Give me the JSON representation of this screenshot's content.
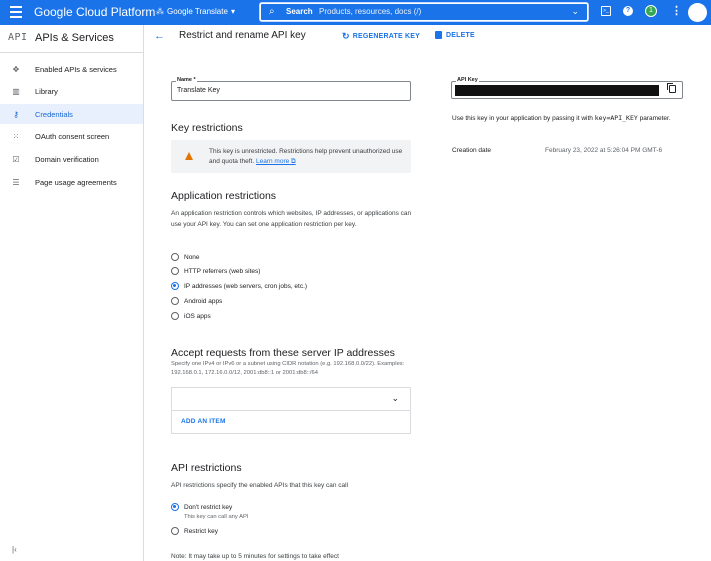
{
  "topbar": {
    "brand": "Google Cloud Platform",
    "project": "Google Translate",
    "search_label": "Search",
    "search_placeholder": "Products, resources, docs (/)",
    "notification_count": "1"
  },
  "sidebar": {
    "logo": "API",
    "title": "APIs & Services",
    "items": [
      {
        "label": "Enabled APIs & services",
        "icon": "diamond-grid-icon"
      },
      {
        "label": "Library",
        "icon": "library-icon"
      },
      {
        "label": "Credentials",
        "icon": "key-icon",
        "active": true
      },
      {
        "label": "OAuth consent screen",
        "icon": "consent-grid-icon"
      },
      {
        "label": "Domain verification",
        "icon": "domain-check-icon"
      },
      {
        "label": "Page usage agreements",
        "icon": "settings-list-icon"
      }
    ]
  },
  "header": {
    "title": "Restrict and rename API key",
    "regenerate": "REGENERATE KEY",
    "delete": "DELETE"
  },
  "form": {
    "name_label": "Name *",
    "name_value": "Translate Key",
    "key_restrictions_heading": "Key restrictions",
    "warning_text": "This key is unrestricted. Restrictions help prevent unauthorized use and quota theft.",
    "learn_more": "Learn more",
    "app_restrictions_heading": "Application restrictions",
    "app_restrictions_desc": "An application restriction controls which websites, IP addresses, or applications can use your API key. You can set one application restriction per key.",
    "app_options": [
      "None",
      "HTTP referrers (web sites)",
      "IP addresses (web servers, cron jobs, etc.)",
      "Android apps",
      "iOS apps"
    ],
    "app_selected": "IP addresses (web servers, cron jobs, etc.)",
    "ip_heading": "Accept requests from these server IP addresses",
    "ip_desc": "Specify one IPv4 or IPv6 or a subnet using CIDR notation (e.g. 192.168.0.0/22). Examples: 192.168.0.1, 172.16.0.0/12, 2001:db8::1 or 2001:db8::/64",
    "add_item": "ADD AN ITEM",
    "api_restrictions_heading": "API restrictions",
    "api_restrictions_desc": "API restrictions specify the enabled APIs that this key can call",
    "api_options": [
      "Don't restrict key",
      "Restrict key"
    ],
    "api_selected": "Don't restrict key",
    "api_option_sub": "This key can call any API",
    "note": "Note: It may take up to 5 minutes for settings to take effect"
  },
  "key_panel": {
    "label": "API Key",
    "usage_prefix": "Use this key in your application by passing it with",
    "usage_param": "key=API_KEY",
    "usage_suffix": "parameter.",
    "created_label": "Creation date",
    "created_value": "February 23, 2022 at 5:26:04 PM GMT-6"
  },
  "colors": {
    "accent": "#1a73e8",
    "warning": "#e37400",
    "active_bg": "#e8f0fe"
  }
}
